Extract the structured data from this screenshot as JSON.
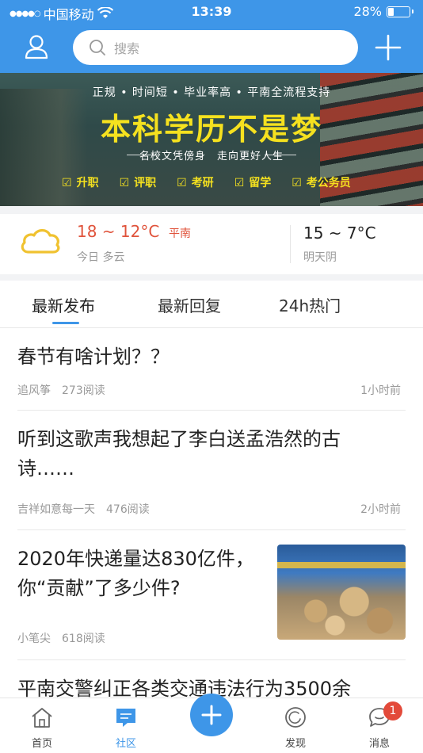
{
  "status_bar": {
    "carrier": "中国移动",
    "time": "13:39",
    "battery_text": "28%",
    "battery_level": 0.28
  },
  "header": {
    "search_placeholder": "搜索",
    "user_icon": "user-icon",
    "add_icon": "plus-icon"
  },
  "banner": {
    "tagline": "正规 • 时间短 • 毕业率高 • 平南全流程支持",
    "headline": "本科学历不是梦",
    "subline": "名校文凭傍身　走向更好人生",
    "chips": [
      "升职",
      "评职",
      "考研",
      "留学",
      "考公务员"
    ]
  },
  "weather": {
    "today_temp": "18 ~ 12°C",
    "city": "平南",
    "today_desc": "今日 多云",
    "tomorrow_temp": "15 ~ 7°C",
    "tomorrow_desc": "明天阴",
    "icon": "cloud-icon"
  },
  "tabs": [
    {
      "label": "最新发布",
      "active": true
    },
    {
      "label": "最新回复",
      "active": false
    },
    {
      "label": "24h热门",
      "active": false
    }
  ],
  "feed": [
    {
      "title": "春节有啥计划？？",
      "author": "追风筝",
      "reads": "273阅读",
      "time": "1小时前"
    },
    {
      "title": "听到这歌声我想起了李白送孟浩然的古诗……",
      "author": "吉祥如意每一天",
      "reads": "476阅读",
      "time": "2小时前"
    },
    {
      "title": "2020年快递量达830亿件，你“贡献”了多少件?",
      "author": "小笔尖",
      "reads": "618阅读",
      "time": ""
    },
    {
      "title": "平南交警纠正各类交通违法行为3500余",
      "author": "",
      "reads": "",
      "time": ""
    }
  ],
  "bottom_nav": [
    {
      "label": "首页",
      "icon": "home-icon"
    },
    {
      "label": "社区",
      "icon": "community-icon",
      "active": true
    },
    {
      "label": "",
      "icon": "plus-icon"
    },
    {
      "label": "发现",
      "icon": "discover-icon"
    },
    {
      "label": "消息",
      "icon": "message-icon",
      "badge": "1"
    }
  ],
  "colors": {
    "brand": "#3e96e8",
    "accent_red": "#e0533b",
    "banner_yellow": "#f5e11f"
  }
}
